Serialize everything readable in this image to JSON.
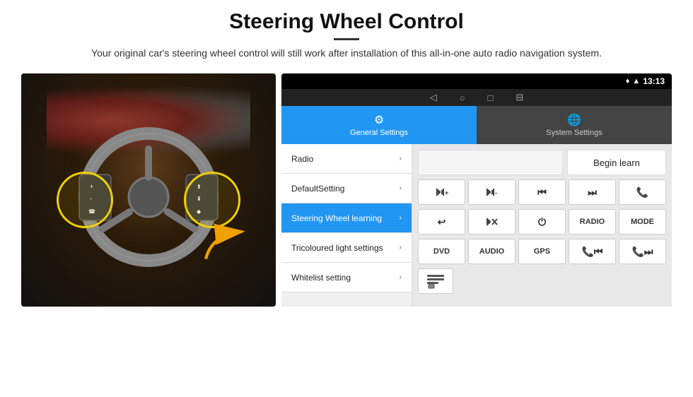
{
  "header": {
    "title": "Steering Wheel Control",
    "divider": true,
    "subtitle": "Your original car's steering wheel control will still work after installation of this all-in-one auto radio navigation system."
  },
  "status_bar": {
    "time": "13:13",
    "wifi_icon": "▾",
    "signal_icon": "▲"
  },
  "nav_bar": {
    "back_icon": "◁",
    "home_icon": "○",
    "recent_icon": "□",
    "cast_icon": "⊟"
  },
  "tabs": {
    "general": {
      "label": "General Settings",
      "icon": "⚙"
    },
    "system": {
      "label": "System Settings",
      "icon": "🌐"
    }
  },
  "menu": {
    "items": [
      {
        "label": "Radio",
        "active": false
      },
      {
        "label": "DefaultSetting",
        "active": false
      },
      {
        "label": "Steering Wheel learning",
        "active": true
      },
      {
        "label": "Tricoloured light settings",
        "active": false
      },
      {
        "label": "Whitelist setting",
        "active": false
      }
    ]
  },
  "panel": {
    "begin_learn_label": "Begin learn",
    "row1_buttons": [
      {
        "label": "🔊+",
        "name": "vol-up-btn"
      },
      {
        "label": "🔊-",
        "name": "vol-down-btn"
      },
      {
        "label": "⏮",
        "name": "prev-track-btn"
      },
      {
        "label": "⏭",
        "name": "next-track-btn"
      },
      {
        "label": "📞",
        "name": "phone-btn"
      }
    ],
    "row2_buttons": [
      {
        "label": "↩",
        "name": "back-btn"
      },
      {
        "label": "🔇",
        "name": "mute-btn"
      },
      {
        "label": "⏻",
        "name": "power-btn"
      },
      {
        "label": "RADIO",
        "name": "radio-btn"
      },
      {
        "label": "MODE",
        "name": "mode-btn"
      }
    ],
    "row3_buttons": [
      {
        "label": "DVD",
        "name": "dvd-btn"
      },
      {
        "label": "AUDIO",
        "name": "audio-btn"
      },
      {
        "label": "GPS",
        "name": "gps-btn"
      },
      {
        "label": "📞⏮",
        "name": "phone-prev-btn"
      },
      {
        "label": "📞⏭",
        "name": "phone-next-btn"
      }
    ],
    "scan_icon": "≡",
    "scan_btn_name": "scan-btn"
  }
}
